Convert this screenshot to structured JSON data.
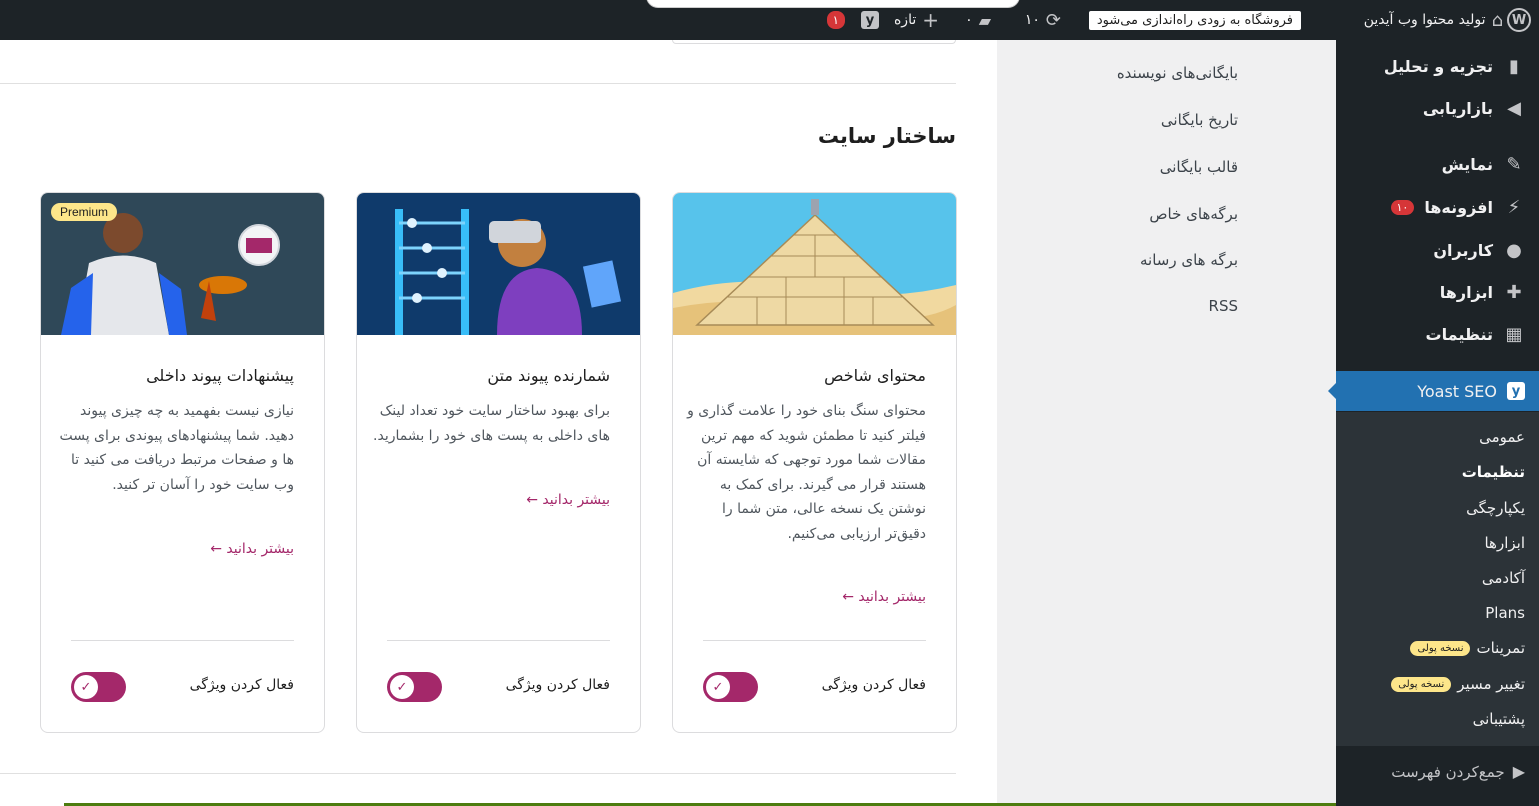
{
  "adminbar": {
    "site_name": "تولید محتوا وب آیدین",
    "notice": "فروشگاه به زودی راه‌اندازی می‌شود",
    "updates_count": "۱۰",
    "comments_count": "۰",
    "new_label": "تازه",
    "yoast_badge": "۱"
  },
  "sidebar": {
    "items": [
      {
        "label": "تجزیه و تحلیل",
        "icon": "bar-chart-icon"
      },
      {
        "label": "بازاریابی",
        "icon": "megaphone-icon"
      },
      {
        "label": "نمایش",
        "icon": "brush-icon"
      },
      {
        "label": "افزونه‌ها",
        "icon": "plugin-icon",
        "badge": "۱۰"
      },
      {
        "label": "کاربران",
        "icon": "user-icon"
      },
      {
        "label": "ابزارها",
        "icon": "wrench-icon"
      },
      {
        "label": "تنظیمات",
        "icon": "settings-icon"
      }
    ],
    "yoast_label": "Yoast SEO",
    "submenu": [
      {
        "label": "عمومی"
      },
      {
        "label": "تنظیمات"
      },
      {
        "label": "یکپارچگی"
      },
      {
        "label": "ابزارها"
      },
      {
        "label": "آکادمی"
      },
      {
        "label": "Plans"
      },
      {
        "label": "تمرینات",
        "paid": "نسخه پولی"
      },
      {
        "label": "تغییر مسیر",
        "paid": "نسخه پولی"
      },
      {
        "label": "پشتیبانی"
      }
    ],
    "collapse_label": "جمع‌کردن فهرست"
  },
  "ynav": {
    "items": [
      "بایگانی‌های نویسنده",
      "تاریخ بایگانی",
      "قالب بایگانی",
      "برگه‌های خاص",
      "برگه های رسانه",
      "RSS"
    ]
  },
  "main": {
    "section_title": "ساختار سایت",
    "cards": [
      {
        "title": "محتوای شاخص",
        "desc": "محتوای سنگ بنای خود را علامت گذاری و فیلتر کنید تا مطمئن شوید که مهم ترین مقالات شما مورد توجهی که شایسته آن هستند قرار می گیرند. برای کمک به نوشتن یک نسخه عالی، متن شما را دقیق‌تر ارزیابی می‌کنیم.",
        "more": "بیشتر بدانید ←",
        "feature": "فعال کردن ویژگی",
        "premium": ""
      },
      {
        "title": "شمارنده پیوند متن",
        "desc": "برای بهبود ساختار سایت خود تعداد لینک های داخلی به پست های خود را بشمارید.",
        "more": "بیشتر بدانید ←",
        "feature": "فعال کردن ویژگی",
        "premium": ""
      },
      {
        "title": "پیشنهادات پیوند داخلی",
        "desc": "نیازی نیست بفهمید به چه چیزی پیوند دهید. شما پیشنهادهای پیوندی برای پست ها و صفحات مرتبط دریافت می کنید تا وب سایت خود را آسان تر کنید.",
        "more": "بیشتر بدانید ←",
        "feature": "فعال کردن ویژگی",
        "premium": "Premium"
      }
    ]
  }
}
